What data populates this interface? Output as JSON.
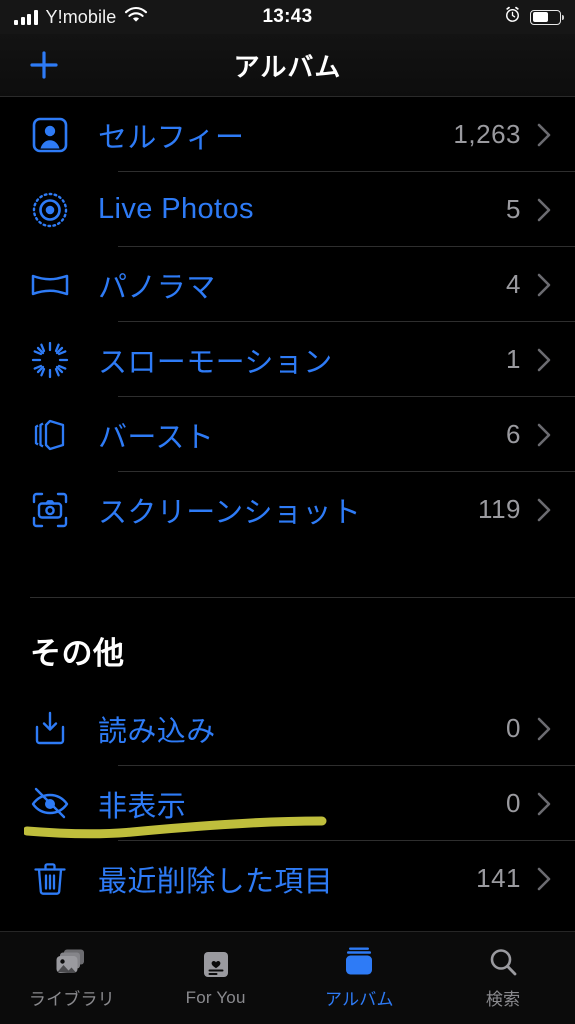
{
  "status_bar": {
    "carrier": "Y!mobile",
    "time": "13:43",
    "signal_icon": "cellular-bars-icon",
    "wifi_icon": "wifi-icon",
    "alarm_icon": "alarm-clock-icon",
    "battery_icon": "battery-icon",
    "battery_level_percent": 60
  },
  "nav_bar": {
    "title": "アルバム",
    "add_icon": "plus-icon"
  },
  "media_types_section": {
    "rows": [
      {
        "icon": "person-in-square-icon",
        "label": "セルフィー",
        "count": "1,263"
      },
      {
        "icon": "live-photos-icon",
        "label": "Live Photos",
        "count": "5"
      },
      {
        "icon": "panorama-icon",
        "label": "パノラマ",
        "count": "4"
      },
      {
        "icon": "slow-motion-icon",
        "label": "スローモーション",
        "count": "1"
      },
      {
        "icon": "burst-icon",
        "label": "バースト",
        "count": "6"
      },
      {
        "icon": "screenshot-camera-icon",
        "label": "スクリーンショット",
        "count": "119"
      }
    ]
  },
  "other_section": {
    "title": "その他",
    "rows": [
      {
        "icon": "import-tray-icon",
        "label": "読み込み",
        "count": "0"
      },
      {
        "icon": "eye-slash-icon",
        "label": "非表示",
        "count": "0"
      },
      {
        "icon": "trash-icon",
        "label": "最近削除した項目",
        "count": "141"
      }
    ]
  },
  "annotation": {
    "type": "handwritten-highlight-underline",
    "target_label": "非表示",
    "color": "#c9c83f"
  },
  "tab_bar": {
    "tabs": [
      {
        "icon": "photo-stack-icon",
        "label": "ライブラリ",
        "active": false
      },
      {
        "icon": "for-you-card-icon",
        "label": "For You",
        "active": false
      },
      {
        "icon": "albums-icon",
        "label": "アルバム",
        "active": true
      },
      {
        "icon": "search-icon",
        "label": "検索",
        "active": false
      }
    ]
  },
  "colors": {
    "accent": "#2e7bf6",
    "background": "#000000",
    "count_text": "#9a9a9f",
    "separator": "#2e2e2e",
    "highlight": "#c9c83f"
  }
}
